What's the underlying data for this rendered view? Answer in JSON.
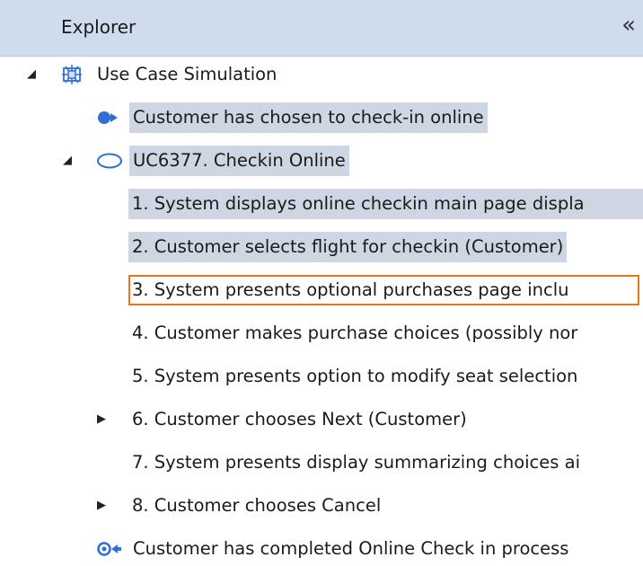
{
  "header": {
    "title": "Explorer",
    "collapse_label": "«"
  },
  "tree": {
    "root": {
      "label": "Use Case Simulation",
      "icon": "simulation-icon",
      "expanded": true
    },
    "precondition": {
      "label": "Customer has chosen to check-in online",
      "icon": "entry-arrow-icon"
    },
    "use_case": {
      "label": "UC6377. Checkin Online",
      "icon": "use-case-ellipse-icon",
      "expanded": true
    },
    "steps": [
      {
        "label": "1. System displays online checkin main page displa",
        "state": "selected"
      },
      {
        "label": "2. Customer selects flight for checkin (Customer)",
        "state": "selected"
      },
      {
        "label": "3. System presents optional purchases page inclu",
        "state": "focused"
      },
      {
        "label": "4. Customer makes purchase choices (possibly nor",
        "state": "normal"
      },
      {
        "label": "5. System presents option to modify seat selection",
        "state": "normal"
      },
      {
        "label": "6. Customer chooses Next (Customer)",
        "state": "normal",
        "collapsed": true
      },
      {
        "label": "7. System presents display summarizing choices ai",
        "state": "normal"
      },
      {
        "label": "8. Customer chooses Cancel",
        "state": "normal",
        "collapsed": true
      }
    ],
    "postcondition": {
      "label": "Customer has completed Online Check in process",
      "icon": "exit-arrow-icon"
    }
  },
  "colors": {
    "header_bg": "#cfdcee",
    "selection_bg": "#cdd6e2",
    "focus_border": "#e8761c",
    "icon_blue": "#2f6fd6"
  }
}
